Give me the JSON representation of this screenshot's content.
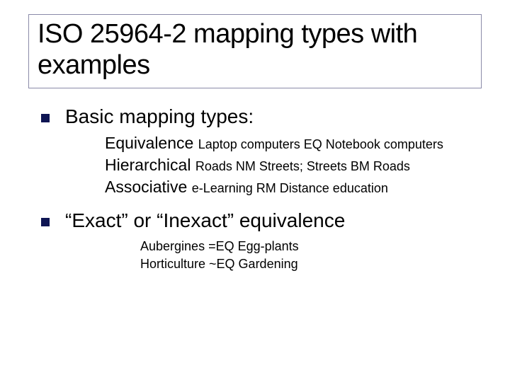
{
  "title": "ISO 25964-2 mapping types with examples",
  "sections": [
    {
      "heading": "Basic mapping types:",
      "items": [
        {
          "label": "Equivalence ",
          "example": "Laptop computers  EQ  Notebook computers"
        },
        {
          "label": "Hierarchical ",
          "example": "Roads NM Streets;  Streets BM Roads"
        },
        {
          "label": "Associative  ",
          "example": "e-Learning  RM  Distance education"
        }
      ]
    },
    {
      "heading": "“Exact” or “Inexact” equivalence",
      "eq_lines": [
        "Aubergines  =EQ  Egg-plants",
        "Horticulture ~EQ  Gardening"
      ]
    }
  ]
}
